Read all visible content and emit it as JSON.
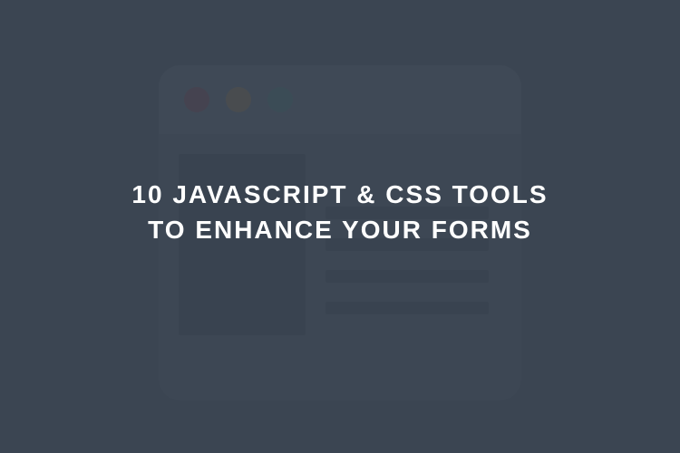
{
  "headline": {
    "line1": "10 JAVASCRIPT & CSS TOOLS",
    "line2": "TO ENHANCE YOUR FORMS"
  },
  "browser_illustration": {
    "traffic_lights": [
      "red",
      "yellow",
      "teal"
    ]
  }
}
